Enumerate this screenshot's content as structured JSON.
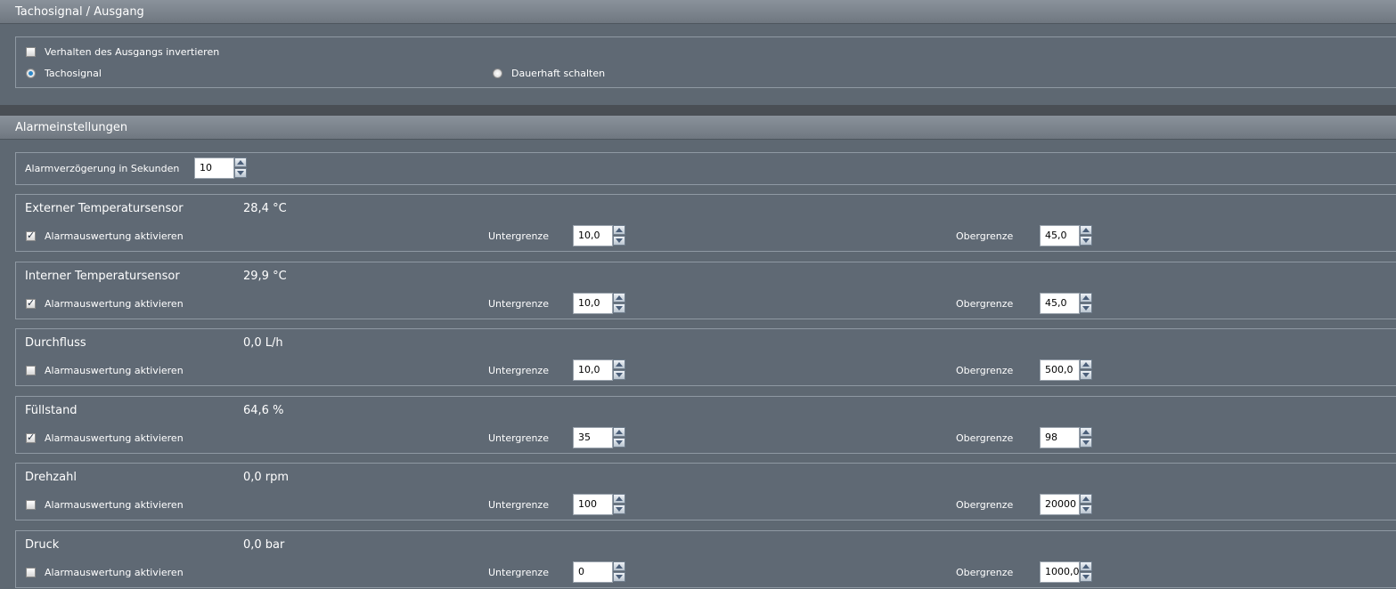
{
  "tacho": {
    "title": "Tachosignal / Ausgang",
    "invert_label": "Verhalten des Ausgangs invertieren",
    "invert_checked": false,
    "radio_tacho_label": "Tachosignal",
    "radio_permanent_label": "Dauerhaft schalten",
    "selected": "tachosignal"
  },
  "alarm": {
    "title": "Alarmeinstellungen",
    "delay_label": "Alarmverzögerung in Sekunden",
    "delay_value": "10",
    "enable_label": "Alarmauswertung aktivieren",
    "lower_label": "Untergrenze",
    "upper_label": "Obergrenze",
    "sensors": [
      {
        "name": "Externer Temperatursensor",
        "value": "28,4 °C",
        "enabled": true,
        "lower": "10,0",
        "upper": "45,0"
      },
      {
        "name": "Interner Temperatursensor",
        "value": "29,9 °C",
        "enabled": true,
        "lower": "10,0",
        "upper": "45,0"
      },
      {
        "name": "Durchfluss",
        "value": "0,0 L/h",
        "enabled": false,
        "lower": "10,0",
        "upper": "500,0"
      },
      {
        "name": "Füllstand",
        "value": "64,6 %",
        "enabled": true,
        "lower": "35",
        "upper": "98"
      },
      {
        "name": "Drehzahl",
        "value": "0,0 rpm",
        "enabled": false,
        "lower": "100",
        "upper": "20000"
      },
      {
        "name": "Druck",
        "value": "0,0 bar",
        "enabled": false,
        "lower": "0",
        "upper": "1000,0"
      }
    ]
  }
}
